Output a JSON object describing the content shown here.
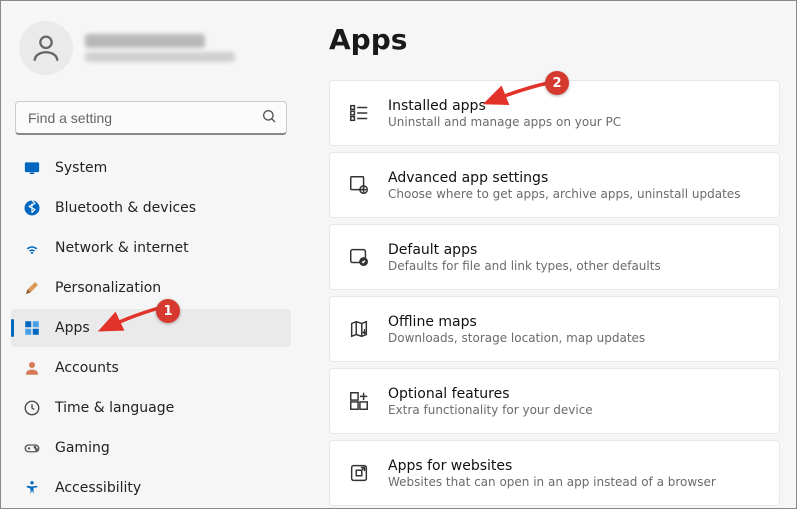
{
  "profile": {
    "name_redacted": true,
    "email_redacted": true
  },
  "search": {
    "placeholder": "Find a setting"
  },
  "sidebar": {
    "items": [
      {
        "label": "System",
        "icon": "system-icon"
      },
      {
        "label": "Bluetooth & devices",
        "icon": "bluetooth-icon"
      },
      {
        "label": "Network & internet",
        "icon": "network-icon"
      },
      {
        "label": "Personalization",
        "icon": "personalization-icon"
      },
      {
        "label": "Apps",
        "icon": "apps-icon",
        "selected": true
      },
      {
        "label": "Accounts",
        "icon": "accounts-icon"
      },
      {
        "label": "Time & language",
        "icon": "time-language-icon"
      },
      {
        "label": "Gaming",
        "icon": "gaming-icon"
      },
      {
        "label": "Accessibility",
        "icon": "accessibility-icon"
      }
    ]
  },
  "page": {
    "title": "Apps",
    "cards": [
      {
        "icon": "installed-apps-icon",
        "title": "Installed apps",
        "sub": "Uninstall and manage apps on your PC"
      },
      {
        "icon": "advanced-app-settings-icon",
        "title": "Advanced app settings",
        "sub": "Choose where to get apps, archive apps, uninstall updates"
      },
      {
        "icon": "default-apps-icon",
        "title": "Default apps",
        "sub": "Defaults for file and link types, other defaults"
      },
      {
        "icon": "offline-maps-icon",
        "title": "Offline maps",
        "sub": "Downloads, storage location, map updates"
      },
      {
        "icon": "optional-features-icon",
        "title": "Optional features",
        "sub": "Extra functionality for your device"
      },
      {
        "icon": "apps-for-websites-icon",
        "title": "Apps for websites",
        "sub": "Websites that can open in an app instead of a browser"
      }
    ]
  },
  "annotations": {
    "marker1": "1",
    "marker2": "2",
    "colors": {
      "marker_bg": "#d63a2f",
      "arrow": "#e2322a"
    }
  }
}
